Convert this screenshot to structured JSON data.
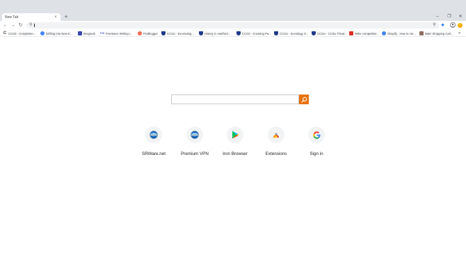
{
  "tabs": [
    {
      "title": "New Tab"
    }
  ],
  "window": {
    "minimize": "–",
    "restore": "❐",
    "close": "✕"
  },
  "omnibox": {
    "value": "",
    "placeholder": ""
  },
  "bookmarks": [
    {
      "label": "CCSS - Completeo...",
      "icon": "c-icon",
      "color": "#3c4043"
    },
    {
      "label": "Drifting into New E...",
      "icon": "globe-icon",
      "color": "#4285f4"
    },
    {
      "label": "Brognutti",
      "icon": "bookmark-icon",
      "color": "#3949ab"
    },
    {
      "label": "Freelance Writing I...",
      "icon": "fw-icon",
      "color": "#5c6bc0"
    },
    {
      "label": "ProBlogger",
      "icon": "pb-icon",
      "color": "#ef6c57"
    },
    {
      "label": "CCSU - Excerating...",
      "icon": "shield-icon",
      "color": "#1e3a8a"
    },
    {
      "label": "History in Hartford...",
      "icon": "shield-icon",
      "color": "#1e3a8a"
    },
    {
      "label": "CCSS - Crossing Pa...",
      "icon": "shield-icon",
      "color": "#1e3a8a"
    },
    {
      "label": "CCSU - Sociology S...",
      "icon": "shield-icon",
      "color": "#1e3a8a"
    },
    {
      "label": "CCSU - CCSU Theat...",
      "icon": "shield-icon",
      "color": "#1e3a8a"
    },
    {
      "label": "Write competitior...",
      "icon": "write-icon",
      "color": "#d93025"
    },
    {
      "label": "Shopify : How to cre...",
      "icon": "globe-icon",
      "color": "#4285f4"
    },
    {
      "label": "M&H Shopping Cart...",
      "icon": "cart-icon",
      "color": "#8d6e63"
    }
  ],
  "search": {
    "value": "",
    "placeholder": "",
    "button_color": "#e8710a"
  },
  "shortcuts": [
    {
      "label": "SRWare.net",
      "icon": "srware-icon"
    },
    {
      "label": "Premium VPN",
      "icon": "vpn-globe-icon"
    },
    {
      "label": "Iron Browser",
      "icon": "play-store-icon"
    },
    {
      "label": "Extensions",
      "icon": "extensions-icon"
    },
    {
      "label": "Sign in",
      "icon": "google-icon"
    }
  ]
}
